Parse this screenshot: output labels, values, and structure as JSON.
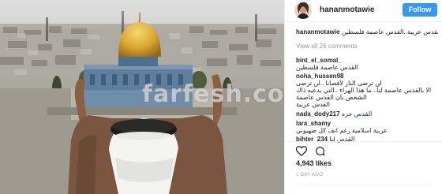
{
  "post": {
    "watermark": "farfesh.com",
    "username": "hananmotawie",
    "follow_label": "Follow"
  },
  "caption": {
    "username": "hananmotawie",
    "text": "القدس عربية..القدس عاصمة فلسطين"
  },
  "view_all": "View all 26 comments",
  "comments": [
    {
      "username": "bint_el_somal_",
      "text": "القدس عاصمة فلسطين"
    },
    {
      "username": "noha_hussen98",
      "text": "لن ترضى النار لأقصانا ..لن ترضى",
      "text2": "الا بالقدس عاصمة لنا...ما هذا الهراء ..التي يدعيه ذاك",
      "text3": "الشخص بأن القدس عاصمة",
      "text4": "القدس عربية"
    },
    {
      "username": "nada_dody217",
      "text": "القدس حره"
    },
    {
      "username": "lara_shamy",
      "text": "عربية اسلامية رغم انف كل صهيوني"
    },
    {
      "username": "bihter_234",
      "text": "القدس لنا"
    }
  ],
  "actions": {
    "likes": "4,943 likes",
    "time": "1 DAY AGO"
  },
  "colors": {
    "accent": "#3897f0",
    "hashtag": "#003569",
    "dome": "#d9a630"
  },
  "icons": {
    "like": "heart-icon",
    "comment": "comment-icon"
  }
}
